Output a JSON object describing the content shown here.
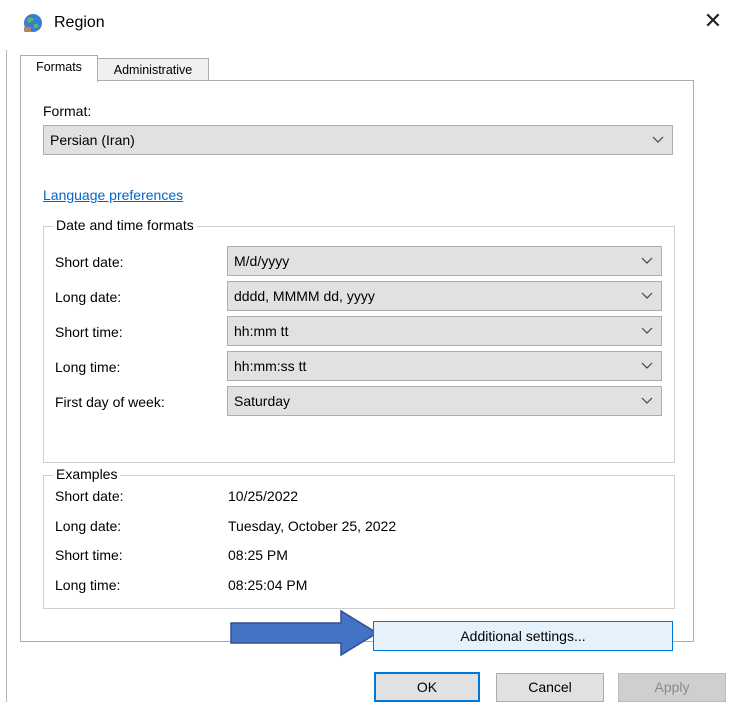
{
  "window": {
    "title": "Region",
    "close_glyph": "✕"
  },
  "tabs": [
    {
      "label": "Formats",
      "selected": true
    },
    {
      "label": "Administrative",
      "selected": false
    }
  ],
  "format": {
    "label": "Format:",
    "value": "Persian (Iran)"
  },
  "language_link": "Language preferences",
  "date_time_formats": {
    "title": "Date and time formats",
    "rows": [
      {
        "label": "Short date:",
        "value": "M/d/yyyy"
      },
      {
        "label": "Long date:",
        "value": "dddd, MMMM dd, yyyy"
      },
      {
        "label": "Short time:",
        "value": "hh:mm tt"
      },
      {
        "label": "Long time:",
        "value": "hh:mm:ss tt"
      },
      {
        "label": "First day of week:",
        "value": "Saturday"
      }
    ]
  },
  "examples": {
    "title": "Examples",
    "rows": [
      {
        "label": "Short date:",
        "value": "10/25/2022"
      },
      {
        "label": "Long date:",
        "value": "Tuesday, October 25, 2022"
      },
      {
        "label": "Short time:",
        "value": "08:25 PM"
      },
      {
        "label": "Long time:",
        "value": "08:25:04 PM"
      }
    ]
  },
  "buttons": {
    "additional": "Additional settings...",
    "ok": "OK",
    "cancel": "Cancel",
    "apply": "Apply"
  },
  "colors": {
    "arrow_fill": "#4472c4",
    "arrow_stroke": "#2f528f",
    "link": "#0066cc",
    "focus_border": "#0078d7"
  }
}
